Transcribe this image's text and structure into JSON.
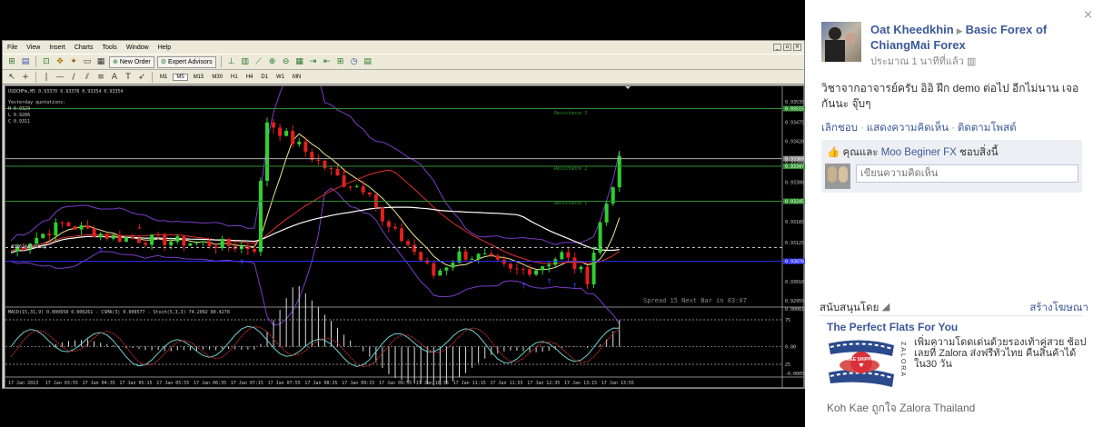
{
  "platform": {
    "menu": [
      "File",
      "View",
      "Insert",
      "Charts",
      "Tools",
      "Window",
      "Help"
    ],
    "toolbar_buttons": {
      "new_order": "New Order",
      "expert_advisors": "Expert Advisors"
    },
    "timeframes": [
      "M1",
      "M5",
      "M15",
      "M30",
      "H1",
      "H4",
      "D1",
      "W1",
      "MN"
    ]
  },
  "chart": {
    "symbol_line": "USDCHFm,M5  0.93370 0.93378 0.93354 0.93354",
    "yesterday": [
      "Yesterday quotations:",
      "H 0.9329",
      "L 0.9286",
      "C 0.9311"
    ],
    "resistance_labels": [
      "Resistance 3",
      "Resistance 2",
      "Resistance 1"
    ],
    "order_label": "#38624433 buy",
    "spread_label": "Spread  15  Next Bar in 03:07",
    "indicator_label": "MACD(15,31,9) 0.000658 0.000261 - CSMA(3) 0.000577 - Stoch(5,3,3) 74.2092 80.4278",
    "price_ticks": [
      "0.93535",
      "0.93475",
      "0.93420",
      "0.93360",
      "0.93300",
      "0.93185",
      "0.93125",
      "0.93070",
      "0.93010",
      "0.92955"
    ],
    "highlighted_prices": [
      "0.93515",
      "0.93369",
      "0.93347",
      "0.93245",
      "0.93070"
    ],
    "indicator_ticks": [
      "0.000815",
      "75",
      "0.00",
      "25",
      "-0.000598"
    ],
    "time_ticks": [
      "17 Jan 2013",
      "17 Jan 03:55",
      "17 Jan 04:35",
      "17 Jan 05:15",
      "17 Jan 05:55",
      "17 Jan 06:35",
      "17 Jan 07:15",
      "17 Jan 07:55",
      "17 Jan 08:35",
      "17 Jan 09:15",
      "17 Jan 09:55",
      "17 Jan 10:35",
      "17 Jan 11:15",
      "17 Jan 11:55",
      "17 Jan 12:35",
      "17 Jan 13:15",
      "17 Jan 13:55"
    ]
  },
  "facebook": {
    "author": "Oat Kheedkhin",
    "group": "Basic Forex of ChiangMai Forex",
    "time": "ประมาณ 1 นาทีที่แล้ว",
    "post_text": "วิชาจากอาจารย์ครับ อิอิ ฝึก demo ต่อไป อีกไม่นาน เจอกันนะ จุ๊บๆ",
    "actions": [
      "เลิกชอบ",
      "แสดงความคิดเห็น",
      "ติดตามโพสต์"
    ],
    "likes_prefix": "คุณและ",
    "likes_name": "Moo Beginer FX",
    "likes_suffix": "ชอบสิ่งนี้",
    "comment_placeholder": "เขียนความคิดเห็น",
    "sponsored_label": "สนับสนุนโดย",
    "create_ad": "สร้างโฆษณา",
    "ad_title": "The Perfect Flats For You",
    "ad_text": "เพิ่มความโดดเด่นด้วยรองเท้าคู่สวย ช้อปเลยที่ Zalora ส่งฟรีทั่วไทย คืนสินค้าได้ใน30 วัน",
    "ad_badge": "FREE SHIPPING",
    "ad_brand": "ZALORA",
    "ad_footer": "Koh Kae ถูกใจ Zalora Thailand"
  }
}
